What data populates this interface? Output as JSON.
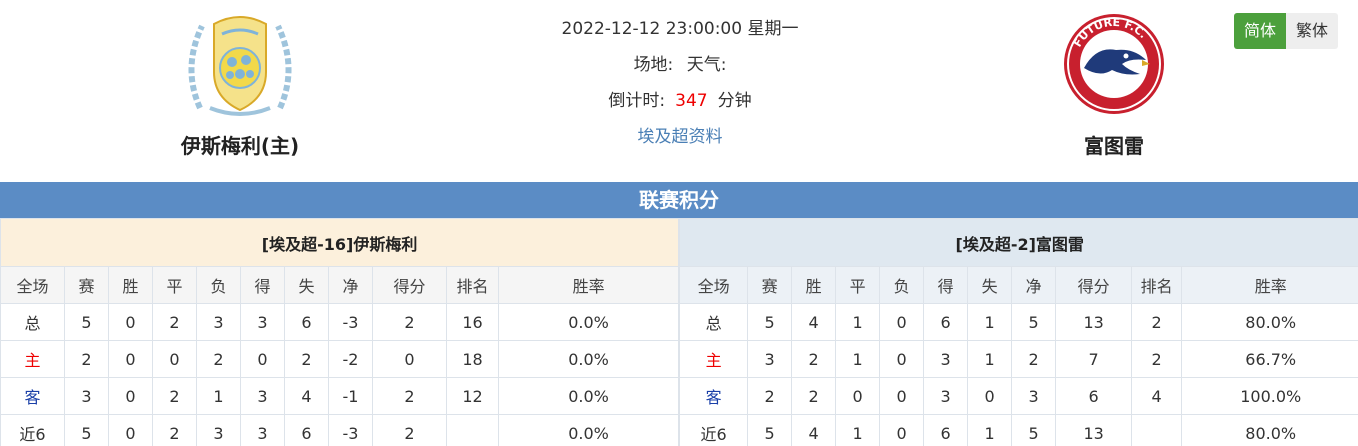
{
  "match": {
    "datetime": "2022-12-12 23:00:00 星期一",
    "venue_label": "场地:",
    "weather_label": "天气:",
    "countdown_label": "倒计时:",
    "countdown_value": "347",
    "countdown_unit": "分钟",
    "league_link": "埃及超资料"
  },
  "home_team": {
    "name": "伊斯梅利(主)",
    "logo_icon": "ismaily-crest-icon",
    "logo_colors": [
      "#f2d94a",
      "#7fb3d9"
    ]
  },
  "away_team": {
    "name": "富图雷",
    "logo_icon": "future-fc-eagle-icon",
    "logo_text": "FUTURE F.C.",
    "logo_colors": [
      "#c8202e",
      "#1f3a7a"
    ]
  },
  "lang": {
    "simplified": "简体",
    "traditional": "繁体"
  },
  "standings": {
    "title": "联赛积分",
    "columns": [
      "全场",
      "赛",
      "胜",
      "平",
      "负",
      "得",
      "失",
      "净",
      "得分",
      "排名",
      "胜率"
    ],
    "home": {
      "header": "[埃及超-16]伊斯梅利",
      "rows": [
        [
          "总",
          "5",
          "0",
          "2",
          "3",
          "3",
          "6",
          "-3",
          "2",
          "16",
          "0.0%"
        ],
        [
          "主",
          "2",
          "0",
          "0",
          "2",
          "0",
          "2",
          "-2",
          "0",
          "18",
          "0.0%"
        ],
        [
          "客",
          "3",
          "0",
          "2",
          "1",
          "3",
          "4",
          "-1",
          "2",
          "12",
          "0.0%"
        ],
        [
          "近6",
          "5",
          "0",
          "2",
          "3",
          "3",
          "6",
          "-3",
          "2",
          "",
          "0.0%"
        ]
      ]
    },
    "away": {
      "header": "[埃及超-2]富图雷",
      "rows": [
        [
          "总",
          "5",
          "4",
          "1",
          "0",
          "6",
          "1",
          "5",
          "13",
          "2",
          "80.0%"
        ],
        [
          "主",
          "3",
          "2",
          "1",
          "0",
          "3",
          "1",
          "2",
          "7",
          "2",
          "66.7%"
        ],
        [
          "客",
          "2",
          "2",
          "0",
          "0",
          "3",
          "0",
          "3",
          "6",
          "4",
          "100.0%"
        ],
        [
          "近6",
          "5",
          "4",
          "1",
          "0",
          "6",
          "1",
          "5",
          "13",
          "",
          "80.0%"
        ]
      ]
    }
  },
  "colors": {
    "accent": "#5b8cc5",
    "countdown": "#e00000",
    "lang_active": "#4ca03c"
  }
}
